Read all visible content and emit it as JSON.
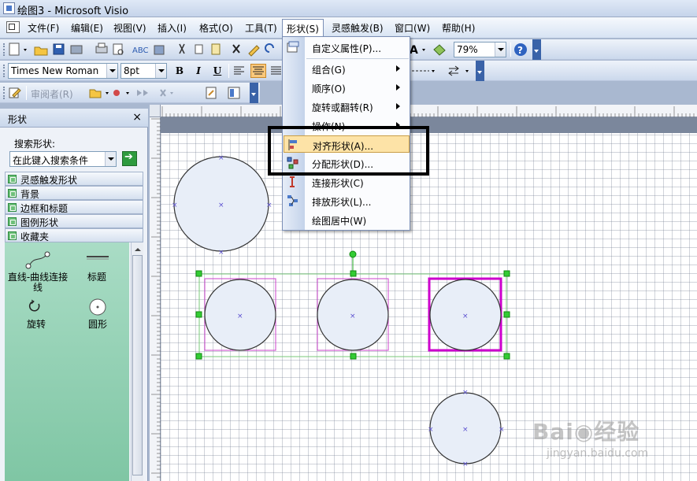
{
  "window": {
    "title": "绘图3 - Microsoft Visio"
  },
  "menubar": {
    "items": [
      {
        "label": "文件(F)"
      },
      {
        "label": "编辑(E)"
      },
      {
        "label": "视图(V)"
      },
      {
        "label": "插入(I)"
      },
      {
        "label": "格式(O)"
      },
      {
        "label": "工具(T)"
      },
      {
        "label": "形状(S)",
        "active": true
      },
      {
        "label": "灵感触发(B)"
      },
      {
        "label": "窗口(W)"
      },
      {
        "label": "帮助(H)"
      }
    ]
  },
  "toolbar": {
    "zoom": "79%",
    "font_name": "Times New Roman",
    "font_size": "8pt",
    "bold": "B",
    "italic": "I",
    "underline": "U",
    "reviewer": "审阅者(R)"
  },
  "shapes_menu": {
    "items": [
      {
        "label": "自定义属性(P)...",
        "icon": "custom-properties-icon",
        "submenu": false
      },
      {
        "label": "组合(G)",
        "submenu": true
      },
      {
        "label": "顺序(O)",
        "submenu": true
      },
      {
        "label": "旋转或翻转(R)",
        "submenu": true
      },
      {
        "label": "操作(N)",
        "submenu": true
      },
      {
        "label": "对齐形状(A)...",
        "icon": "align-shapes-icon",
        "submenu": false,
        "highlighted": true
      },
      {
        "label": "分配形状(D)...",
        "icon": "distribute-shapes-icon",
        "submenu": false
      },
      {
        "label": "连接形状(C)",
        "icon": "connect-shapes-icon",
        "submenu": false
      },
      {
        "label": "排放形状(L)...",
        "icon": "lay-out-shapes-icon",
        "submenu": false
      },
      {
        "label": "绘图居中(W)",
        "submenu": false
      }
    ]
  },
  "shapes_pane": {
    "title": "形状",
    "close": "×",
    "search_label": "搜索形状:",
    "search_placeholder": "在此键入搜索条件",
    "stencils": [
      "灵感触发形状",
      "背景",
      "边框和标题",
      "图例形状",
      "收藏夹"
    ],
    "masters": [
      {
        "label": "直线-曲线连接线",
        "icon": "dynamic-connector-icon"
      },
      {
        "label": "标题",
        "icon": "title-icon"
      },
      {
        "label": "旋转",
        "icon": "rotate-icon"
      },
      {
        "label": "圆形",
        "icon": "circle-icon"
      }
    ]
  },
  "colors": {
    "shape_fill": "#e8eef8",
    "selection_primary": "#cc00cc",
    "selection_secondary": "#cc44cc",
    "handle": "#22bb22",
    "menu_highlight": "#fde3a7",
    "highlight_box": "#000000"
  },
  "watermark": {
    "text": "Bai 经验",
    "sub": "jingyan.baidu.com"
  }
}
